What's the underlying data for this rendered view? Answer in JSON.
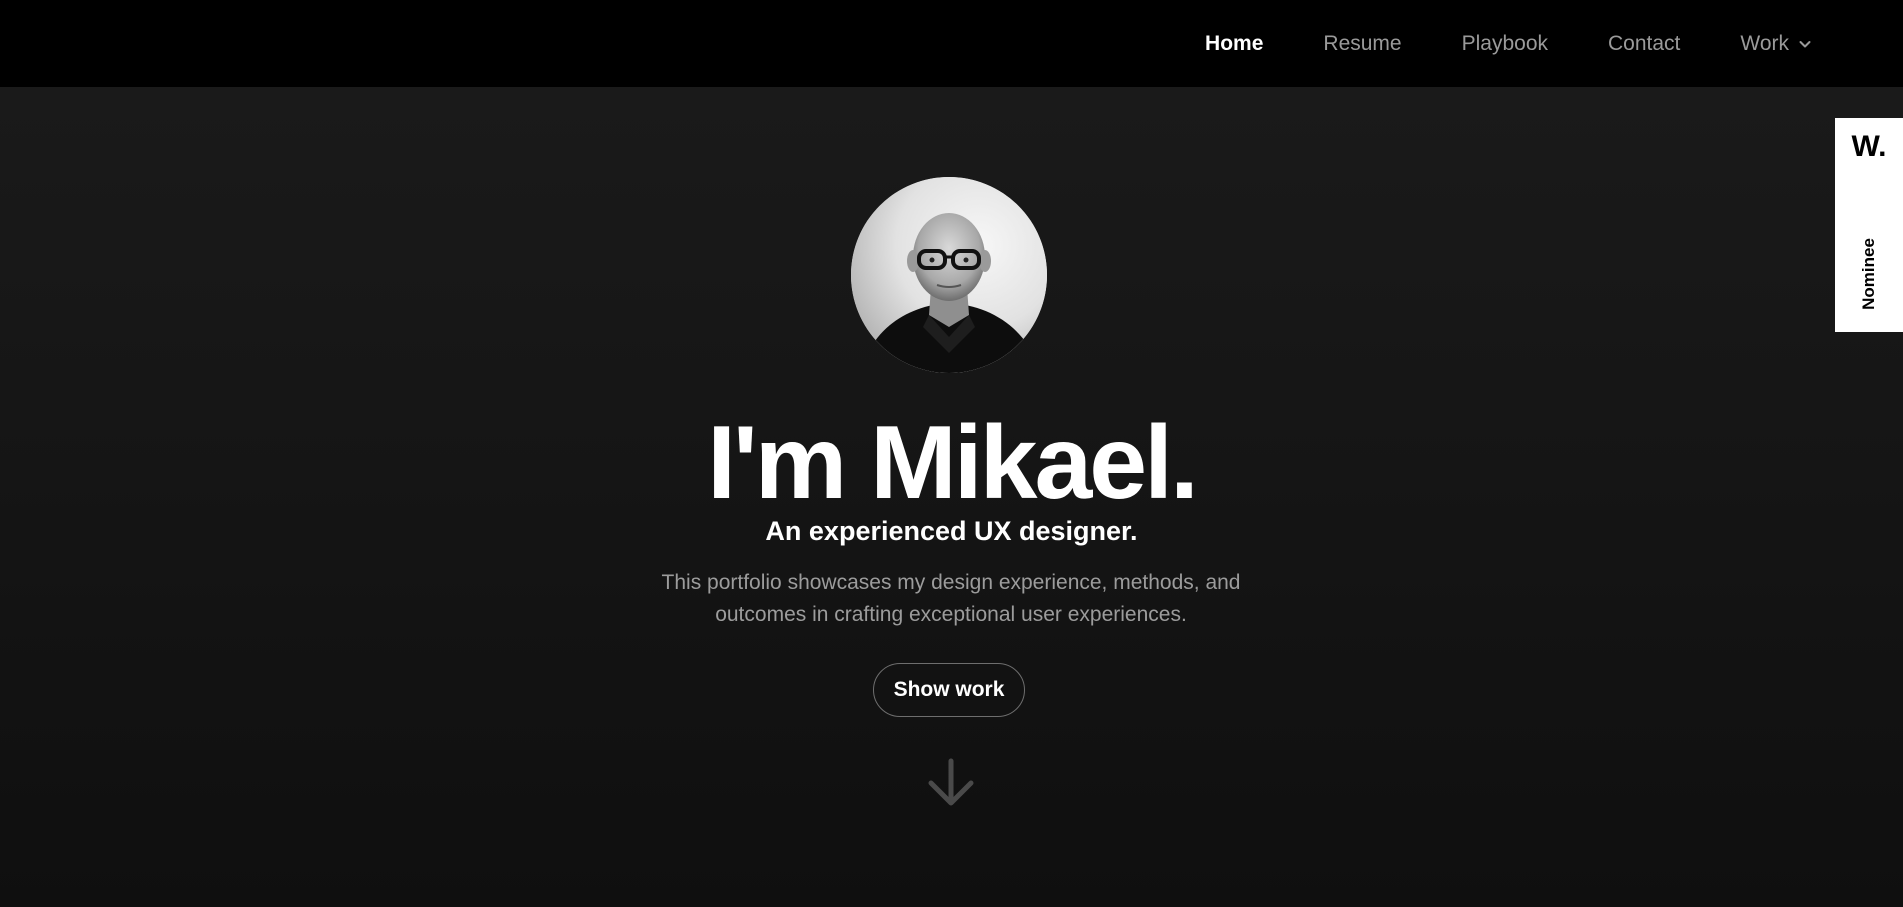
{
  "nav": {
    "items": [
      {
        "label": "Home",
        "active": true
      },
      {
        "label": "Resume",
        "active": false
      },
      {
        "label": "Playbook",
        "active": false
      },
      {
        "label": "Contact",
        "active": false
      },
      {
        "label": "Work",
        "active": false,
        "has_dropdown": true
      }
    ]
  },
  "hero": {
    "avatar_icon": "portrait-photo",
    "title": "I'm Mikael.",
    "subtitle": "An experienced UX designer.",
    "description": "This portfolio showcases my design experience, methods, and outcomes in crafting exceptional user experiences.",
    "cta_label": "Show work",
    "scroll_icon": "arrow-down-icon"
  },
  "badge": {
    "logo": "W.",
    "label": "Nominee"
  },
  "colors": {
    "background": "#141414",
    "nav_background": "#000000",
    "text_primary": "#ffffff",
    "text_muted": "#9c9c9c",
    "button_border": "#6e6e6e"
  }
}
